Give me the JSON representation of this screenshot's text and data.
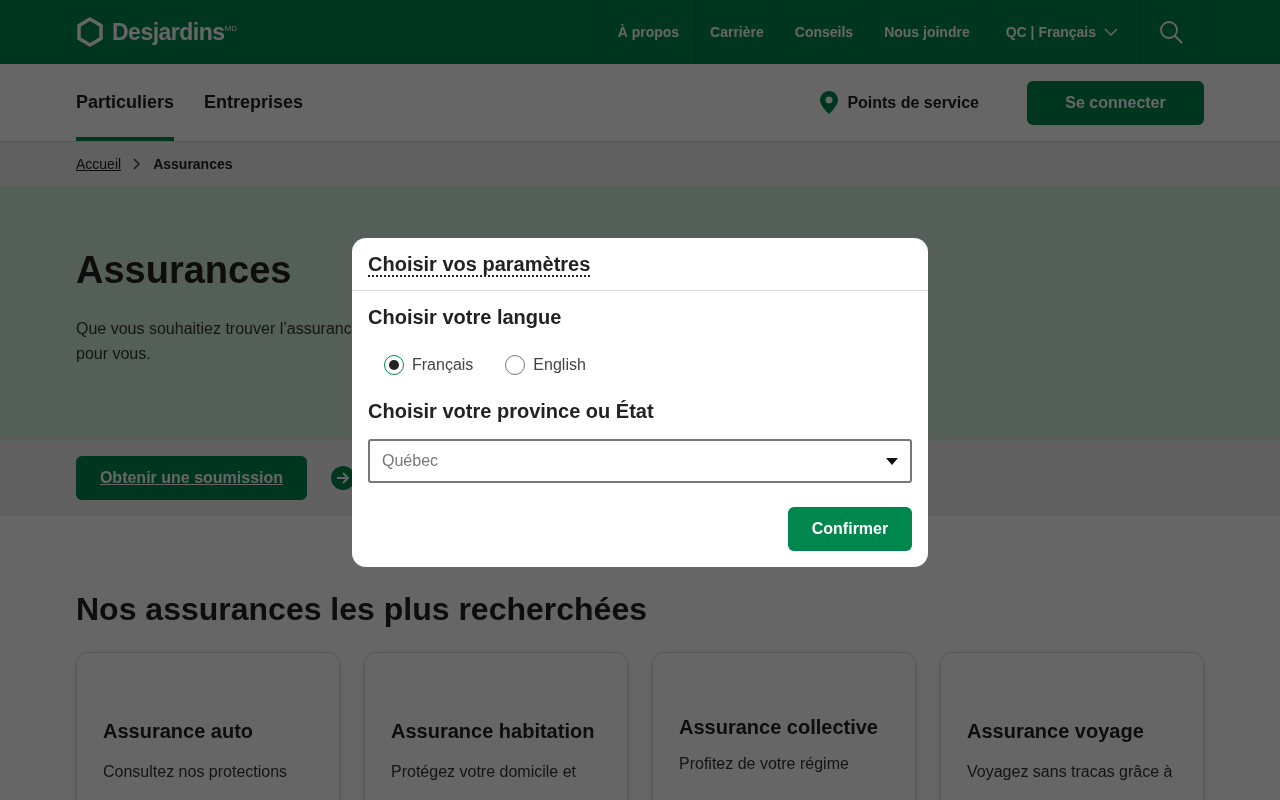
{
  "header": {
    "logo": "Desjardins",
    "logo_mark": "MD",
    "links": [
      "À propos",
      "Carrière",
      "Conseils",
      "Nous joindre"
    ],
    "region": "QC | Français"
  },
  "subnav": {
    "tabs": [
      {
        "label": "Particuliers",
        "selected": true
      },
      {
        "label": "Entreprises",
        "selected": false
      }
    ],
    "service_points": "Points de service",
    "login": "Se connecter"
  },
  "breadcrumb": [
    {
      "label": "Accueil",
      "link": true
    },
    {
      "label": "Assurances",
      "link": false
    }
  ],
  "hero": {
    "title": "Assurances",
    "lines": [
      "Que vous souhaitiez trouver l’assuranc",
      "pour vous."
    ]
  },
  "cta": {
    "button": "Obtenir une soumission"
  },
  "section": {
    "title": "Nos assurances les plus recherchées",
    "cards": [
      {
        "title": "Assurance auto",
        "text": "Consultez nos protections"
      },
      {
        "title": "Assurance habitation",
        "text": "Protégez votre domicile et"
      },
      {
        "title": "Assurance collective",
        "text": "Profitez de votre régime"
      },
      {
        "title": "Assurance voyage",
        "text": "Voyagez sans tracas grâce à"
      }
    ]
  },
  "modal": {
    "title": "Choisir vos paramètres",
    "language_heading": "Choisir votre langue",
    "languages": [
      {
        "label": "Français",
        "selected": true
      },
      {
        "label": "English",
        "selected": false
      }
    ],
    "province_heading": "Choisir votre province ou État",
    "province": "Québec",
    "confirm": "Confirmer"
  }
}
